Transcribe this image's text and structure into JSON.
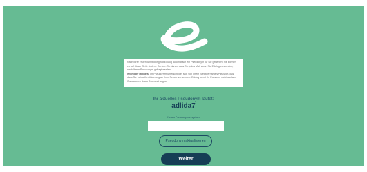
{
  "colors": {
    "background": "#66bb93",
    "navy": "#163e55",
    "white": "#ffffff"
  },
  "logo": {
    "icon": "brand-swoosh-logo"
  },
  "notice": {
    "body": "Nach Ihrer ersten Anmeldung hat Edulog automatisch ein Pseudonym für Sie generiert. Sie können es auf dieser Seite ändern. Denken Sie daran, dass Sie jedes Mal, wenn Sie Edulog verwenden, nach Ihrem Pseudonym gefragt werden.",
    "warning_title": "Wichtiger Hinweis:",
    "warning_body": "Ihr Pseudonym unterscheidet sich von Ihrem Benutzernamen/Passwort, das dass Sie bei Authentifizierung an Ihrer Schule verwenden. Edulog kennt Ihr Passwort nicht und wird Sie nie nach Ihrem Passwort fragen."
  },
  "pseudonym": {
    "label": "Ihr aktuelles Pseudonym lautet:",
    "value": "adlida7"
  },
  "new_pseudonym": {
    "label": "Neues Pseudonym eingeben",
    "value": "",
    "placeholder": ""
  },
  "buttons": {
    "update": "Pseudonym aktualisieren",
    "next": "Weiter"
  }
}
